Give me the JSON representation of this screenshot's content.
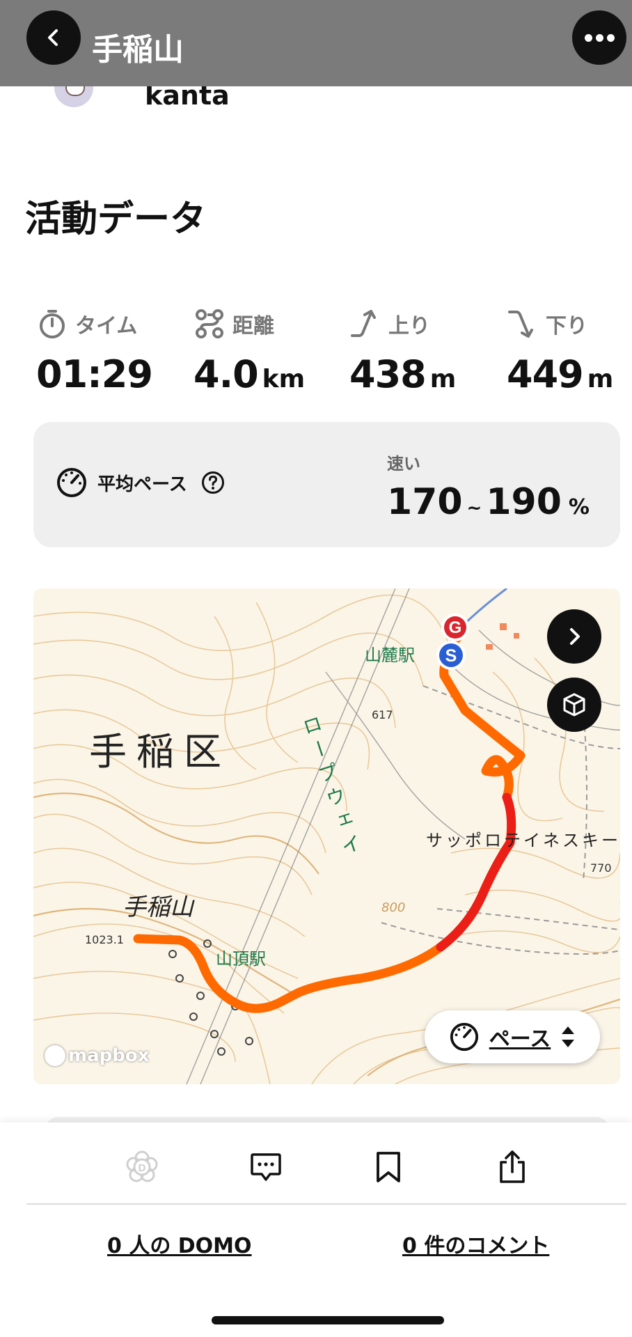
{
  "header": {
    "title": "手稲山"
  },
  "user": {
    "name": "kanta"
  },
  "section": {
    "title": "活動データ"
  },
  "stats": [
    {
      "label": "タイム",
      "value": "01:29",
      "unit": "",
      "icon": "stopwatch-icon"
    },
    {
      "label": "距離",
      "value": "4.0",
      "unit": "km",
      "icon": "route-icon"
    },
    {
      "label": "上り",
      "value": "438",
      "unit": "m",
      "icon": "ascent-arrow-icon"
    },
    {
      "label": "下り",
      "value": "449",
      "unit": "m",
      "icon": "descent-arrow-icon"
    }
  ],
  "pace": {
    "label": "平均ペース",
    "speed_label": "速い",
    "min": "170",
    "separator": "~",
    "max": "190",
    "unit": "%"
  },
  "map": {
    "area_label": "手稲区",
    "summit_label": "手稲山",
    "summit_elevation": "1023.1",
    "station_base": "山麓駅",
    "station_top": "山頂駅",
    "ropeway_label": "ロープウェイ",
    "ski_area_label": "サッポロテイネスキー",
    "elevation_617": "617",
    "elevation_770": "770",
    "contour_800": "800",
    "goal_marker": "G",
    "start_marker": "S",
    "attribution": "mapbox",
    "pace_selector": "ペース",
    "route_colors": {
      "fast": "#ff6a00",
      "slow": "#e8121b"
    }
  },
  "actions": {
    "domo_count": "0 人の DOMO",
    "comment_count": "0 件のコメント"
  }
}
